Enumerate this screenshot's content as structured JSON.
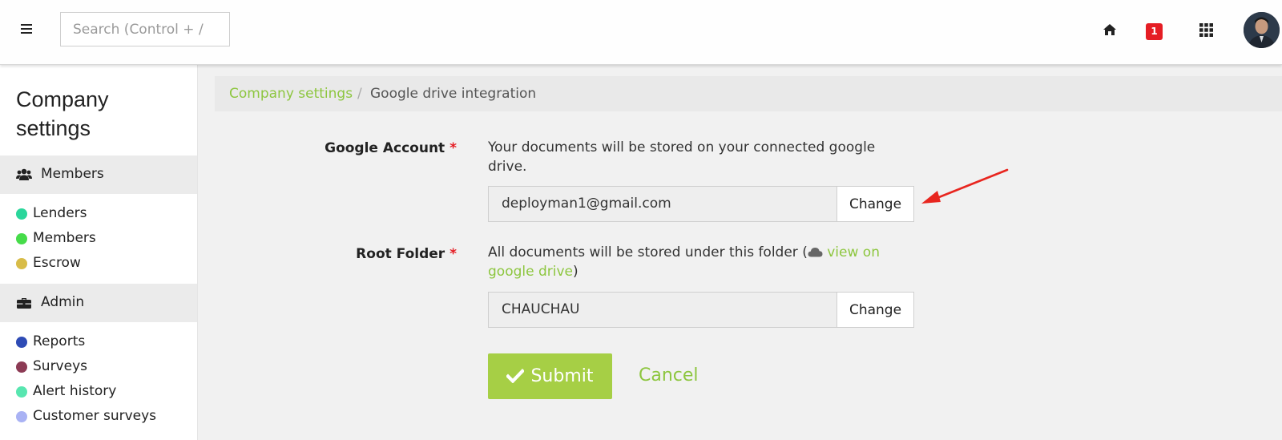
{
  "topbar": {
    "search_placeholder": "Search (Control + /",
    "notifications_count": "1",
    "accent_color": "#e51d24"
  },
  "sidebar": {
    "title": "Company settings",
    "sections": [
      {
        "label": "Members",
        "icon": "users-icon",
        "items": [
          {
            "label": "Lenders",
            "color": "#2ad69b"
          },
          {
            "label": "Members",
            "color": "#46dc4a"
          },
          {
            "label": "Escrow",
            "color": "#d8bc48"
          }
        ]
      },
      {
        "label": "Admin",
        "icon": "briefcase-icon",
        "items": [
          {
            "label": "Reports",
            "color": "#2e4bb5"
          },
          {
            "label": "Surveys",
            "color": "#8c3b55"
          },
          {
            "label": "Alert history",
            "color": "#58e6b0"
          },
          {
            "label": "Customer surveys",
            "color": "#a9b2f4"
          }
        ]
      }
    ]
  },
  "breadcrumb": {
    "parent": "Company settings",
    "separator": "/",
    "current": "Google drive integration"
  },
  "form": {
    "google_account": {
      "label": "Google Account",
      "required_mark": "*",
      "help": "Your documents will be stored on your connected google drive.",
      "value": "deployman1@gmail.com",
      "button": "Change"
    },
    "root_folder": {
      "label": "Root Folder",
      "required_mark": "*",
      "help_prefix": "All documents will be stored under this folder (",
      "help_link": "view on google drive",
      "help_suffix": ")",
      "value": "CHAUCHAU",
      "button": "Change"
    },
    "submit_label": "Submit",
    "cancel_label": "Cancel",
    "accent_color": "#8dc63f"
  }
}
